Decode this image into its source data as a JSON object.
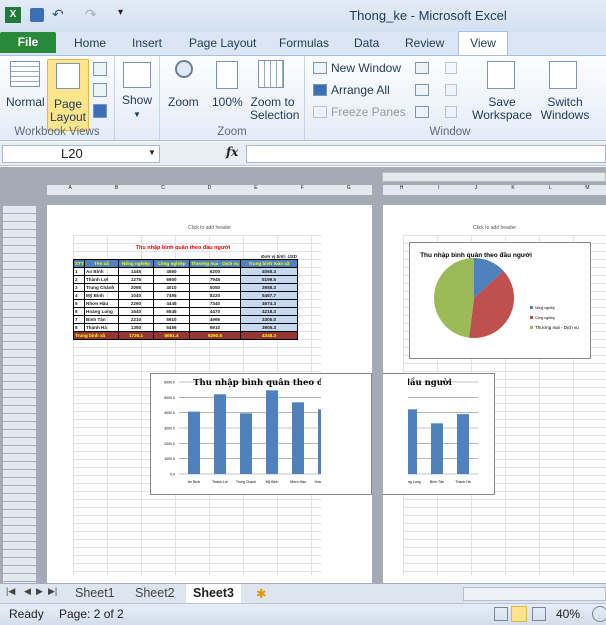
{
  "window": {
    "title": "Thong_ke - Microsoft Excel"
  },
  "tabs": [
    "File",
    "Home",
    "Insert",
    "Page Layout",
    "Formulas",
    "Data",
    "Review",
    "View"
  ],
  "ribbon": {
    "groups": [
      "Workbook Views",
      "Zoom",
      "Window"
    ],
    "normal": "Normal",
    "page_layout": "Page Layout",
    "show": "Show",
    "zoom": "Zoom",
    "zoom100": "100%",
    "zoom_sel": "Zoom to Selection",
    "new_window": "New Window",
    "arrange_all": "Arrange All",
    "freeze_panes": "Freeze Panes",
    "save_ws": "Save Workspace",
    "switch_win": "Switch Windows"
  },
  "formula_bar": {
    "name_box": "L20",
    "fx": "fx",
    "value": ""
  },
  "page": {
    "header_placeholder": "Click to add header"
  },
  "columns_page1": [
    "A",
    "B",
    "C",
    "D",
    "E",
    "F",
    "G"
  ],
  "columns_page2": [
    "H",
    "I",
    "J",
    "K",
    "L",
    "M"
  ],
  "table": {
    "title": "Thu nhập bình quân theo đầu người",
    "unit": "Đơn vị tính: USD",
    "headers": [
      "STT",
      "Tên xã",
      "Nông nghiệp",
      "Công nghiệp",
      "Thương mại - Dịch vụ",
      "Trung bình toàn xã"
    ],
    "rows": [
      [
        "1",
        "An Bình",
        "1445",
        "4560",
        "6200",
        "4068.3"
      ],
      [
        "2",
        "Thành Lợi",
        "1275",
        "6900",
        "7945",
        "5199.5"
      ],
      [
        "3",
        "Trung Chánh",
        "2095",
        "4010",
        "5050",
        "3958.3"
      ],
      [
        "4",
        "Mỹ Bình",
        "1040",
        "7495",
        "8220",
        "5457.7"
      ],
      [
        "5",
        "Nhơn Hậu",
        "2260",
        "4445",
        "7340",
        "4674.3"
      ],
      [
        "6",
        "Hoàng Long",
        "1640",
        "6545",
        "4470",
        "4218.3"
      ],
      [
        "7",
        "Bình Tân",
        "2210",
        "5910",
        "4995",
        "3305.0"
      ],
      [
        "8",
        "Thành Hà",
        "1350",
        "5456",
        "6910",
        "3905.3"
      ]
    ],
    "total": [
      "Trung bình xã",
      "1725.1",
      "5051.4",
      "6260.5",
      "4348.3"
    ]
  },
  "chart_data": [
    {
      "type": "bar",
      "title": "Thu nhập bình quân theo đầu người",
      "categories": [
        "An Bình",
        "Thành Lợi",
        "Trung Chánh",
        "Mỹ Bình",
        "Nhơn Hậu",
        "Hoàng Long",
        "Bình Tân",
        "Thành Hà"
      ],
      "values": [
        4068.3,
        5199.5,
        3958.3,
        5457.7,
        4674.3,
        4218.3,
        3305.0,
        3905.3
      ],
      "ylim": [
        0,
        6000
      ],
      "yticks": [
        "0.0",
        "1000.0",
        "2000.0",
        "3000.0",
        "4000.0",
        "5000.0",
        "6000.0"
      ],
      "grid": true,
      "color": "#4f81bd"
    },
    {
      "type": "pie",
      "title": "Thu nhập bình quân theo đầu người",
      "labels": [
        "Nông nghiệp",
        "Công nghiệp",
        "Thương mại - Dịch vụ"
      ],
      "values": [
        1725.1,
        5051.4,
        6260.5
      ],
      "colors": [
        "#4f81bd",
        "#c0504d",
        "#9bbb59"
      ],
      "legend": "right"
    }
  ],
  "sheet_tabs": [
    "Sheet1",
    "Sheet2",
    "Sheet3"
  ],
  "active_sheet": "Sheet3",
  "status": {
    "ready": "Ready",
    "page": "Page: 2 of 2",
    "zoom": "40%"
  }
}
